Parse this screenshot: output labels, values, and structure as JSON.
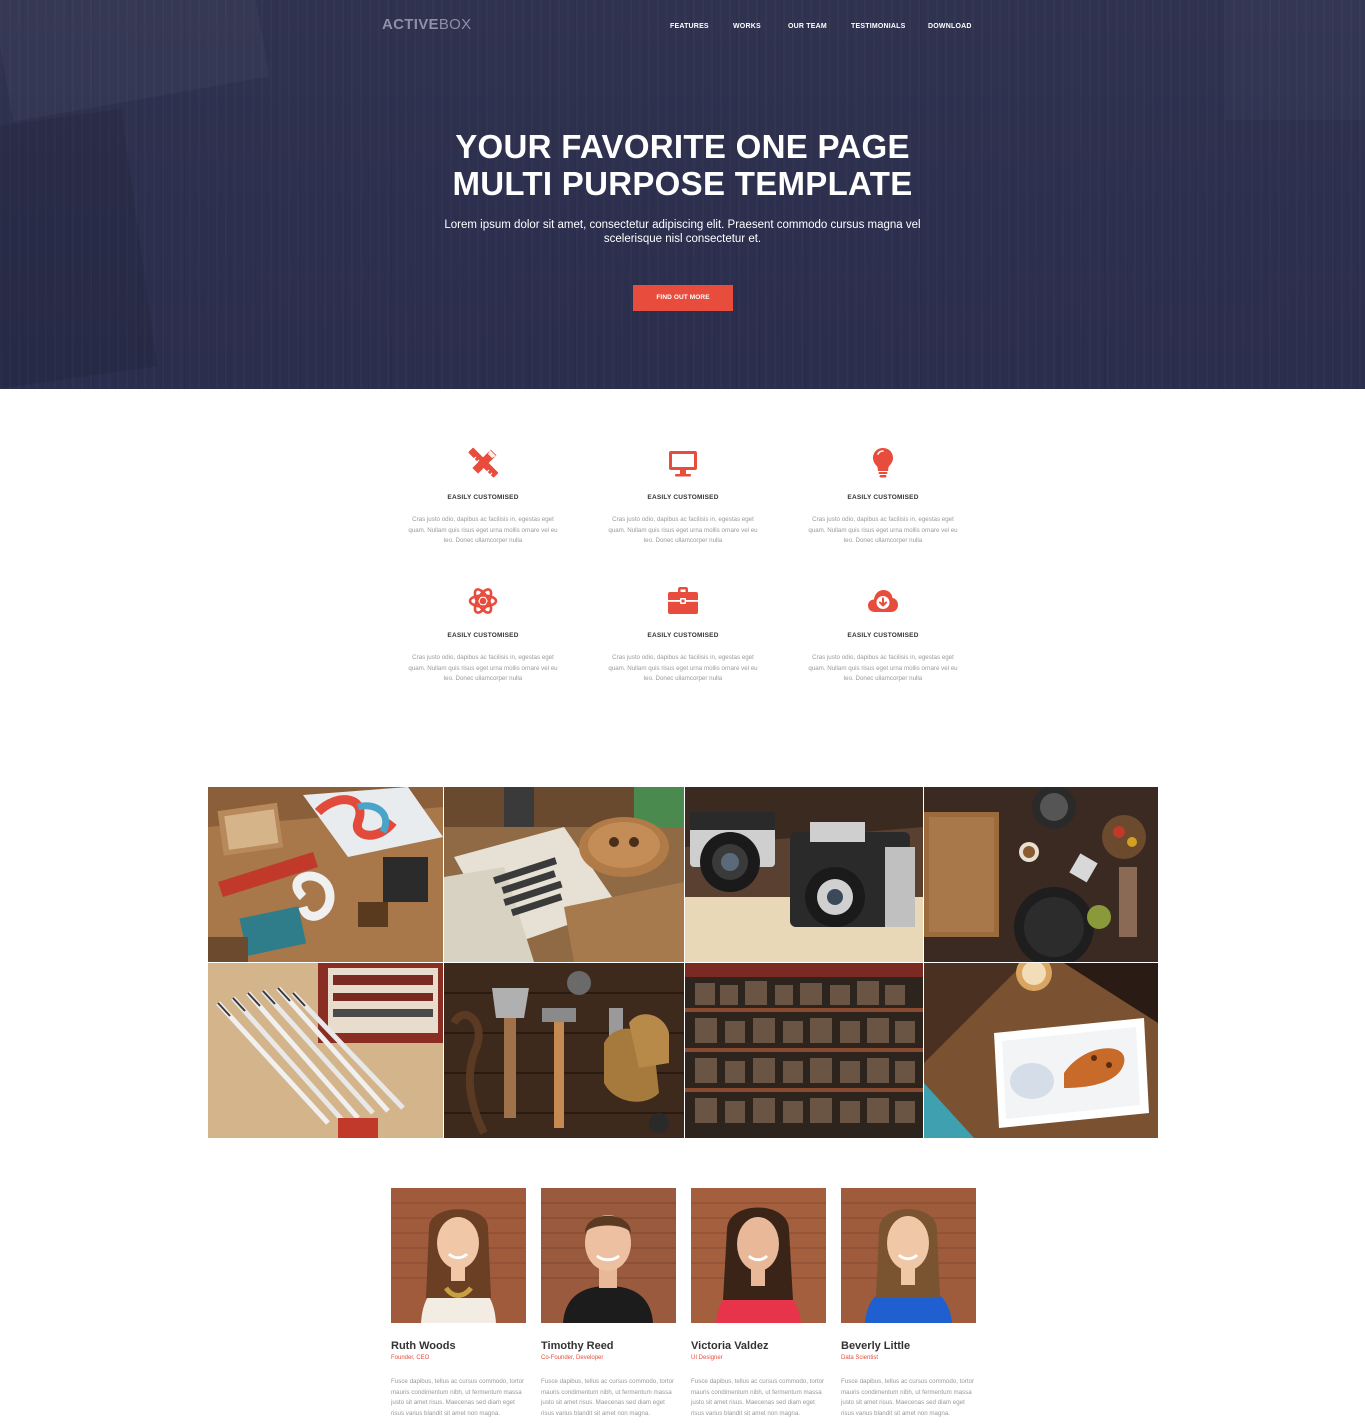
{
  "brand": {
    "logo_bold": "ACTIVE",
    "logo_light": "BOX"
  },
  "colors": {
    "hero_bg": "#2d3050",
    "accent": "#e74c3c",
    "text_dark": "#333333",
    "text_muted": "#9a9a9a"
  },
  "nav": {
    "items": [
      {
        "label": "FEATURES"
      },
      {
        "label": "WORKS"
      },
      {
        "label": "OUR TEAM"
      },
      {
        "label": "TESTIMONIALS"
      },
      {
        "label": "DOWNLOAD"
      }
    ]
  },
  "hero": {
    "title_line1": "YOUR FAVORITE ONE PAGE",
    "title_line2": "MULTI PURPOSE TEMPLATE",
    "subtitle": "Lorem ipsum dolor sit amet, consectetur adipiscing elit. Praesent commodo cursus magna vel scelerisque nisl consectetur et.",
    "cta_label": "FIND OUT MORE"
  },
  "features": [
    {
      "icon": "pencil-ruler-icon",
      "title": "EASILY CUSTOMISED",
      "text": "Cras justo odio, dapibus ac facilisis in, egestas eget quam. Nullam quis risus eget urna mollis ornare vel eu leo. Donec ullamcorper nulla"
    },
    {
      "icon": "monitor-icon",
      "title": "EASILY CUSTOMISED",
      "text": "Cras justo odio, dapibus ac facilisis in, egestas eget quam. Nullam quis risus eget urna mollis ornare vel eu leo. Donec ullamcorper nulla"
    },
    {
      "icon": "lightbulb-icon",
      "title": "EASILY CUSTOMISED",
      "text": "Cras justo odio, dapibus ac facilisis in, egestas eget quam. Nullam quis risus eget urna mollis ornare vel eu leo. Donec ullamcorper nulla"
    },
    {
      "icon": "atom-icon",
      "title": "EASILY CUSTOMISED",
      "text": "Cras justo odio, dapibus ac facilisis in, egestas eget quam. Nullam quis risus eget urna mollis ornare vel eu leo. Donec ullamcorper nulla"
    },
    {
      "icon": "briefcase-icon",
      "title": "EASILY CUSTOMISED",
      "text": "Cras justo odio, dapibus ac facilisis in, egestas eget quam. Nullam quis risus eget urna mollis ornare vel eu leo. Donec ullamcorper nulla"
    },
    {
      "icon": "cloud-download-icon",
      "title": "EASILY CUSTOMISED",
      "text": "Cras justo odio, dapibus ac facilisis in, egestas eget quam. Nullam quis risus eget urna mollis ornare vel eu leo. Donec ullamcorper nulla"
    }
  ],
  "team": [
    {
      "name": "Ruth Woods",
      "role": "Founder, CEO",
      "bio": "Fusce dapibus, tellus ac cursus commodo, tortor mauris condimentum nibh, ut fermentum massa justo sit amet risus. Maecenas sed diam eget risus varius blandit sit amet non magna."
    },
    {
      "name": "Timothy Reed",
      "role": "Co-Founder, Developer",
      "bio": "Fusce dapibus, tellus ac cursus commodo, tortor mauris condimentum nibh, ut fermentum massa justo sit amet risus. Maecenas sed diam eget risus varius blandit sit amet non magna."
    },
    {
      "name": "Victoria Valdez",
      "role": "UI Designer",
      "bio": "Fusce dapibus, tellus ac cursus commodo, tortor mauris condimentum nibh, ut fermentum massa justo sit amet risus. Maecenas sed diam eget risus varius blandit sit amet non magna."
    },
    {
      "name": "Beverly Little",
      "role": "Data Scientist",
      "bio": "Fusce dapibus, tellus ac cursus commodo, tortor mauris condimentum nibh, ut fermentum massa justo sit amet risus. Maecenas sed diam eget risus varius blandit sit amet non magna."
    }
  ]
}
